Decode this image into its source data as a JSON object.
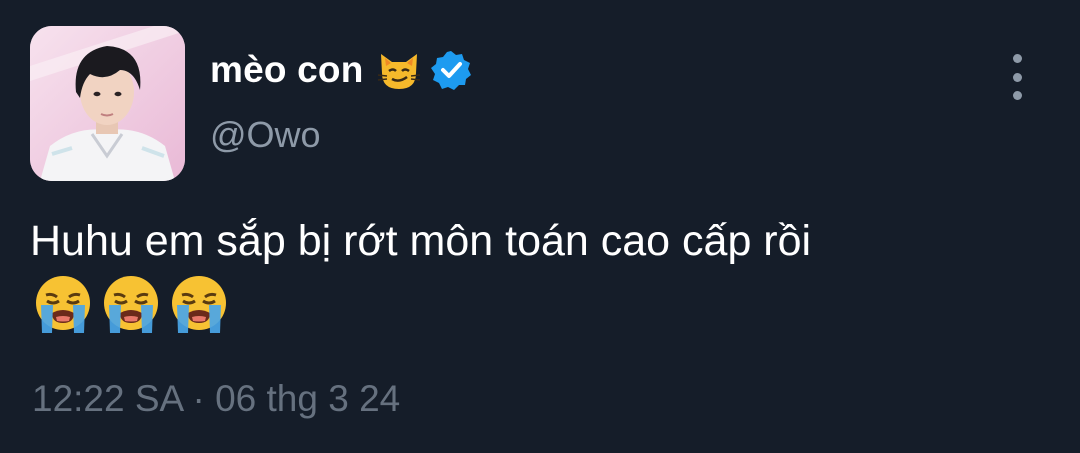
{
  "author": {
    "display_name": "mèo con",
    "handle": "@Owo",
    "name_emoji": "smirking-cat-icon",
    "verified": true,
    "verified_color": "#1d9bf0"
  },
  "tweet": {
    "text": "Huhu em sắp bị rớt môn toán cao cấp rồi",
    "emojis": [
      "loudly-crying-face-icon",
      "loudly-crying-face-icon",
      "loudly-crying-face-icon"
    ],
    "timestamp": "12:22 SA · 06 thg 3 24"
  },
  "colors": {
    "background": "#151d29",
    "text_primary": "#ffffff",
    "text_secondary": "#8e9aa8",
    "timestamp": "#66717f"
  },
  "menu": {
    "icon": "more-vertical-icon"
  }
}
